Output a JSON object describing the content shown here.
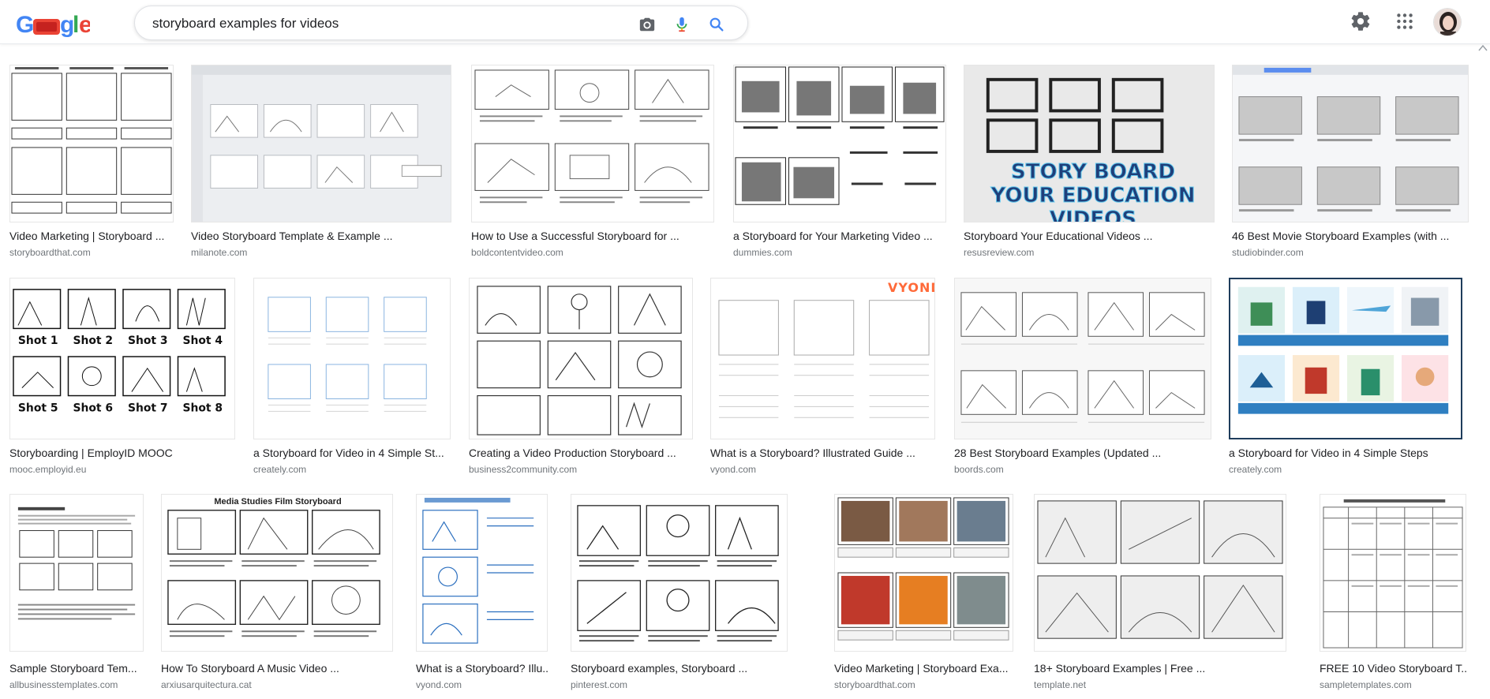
{
  "search": {
    "query": "storyboard examples for videos",
    "placeholder": ""
  },
  "logo": {
    "alt_text": "Google"
  },
  "colors": {
    "blue": "#4285f4",
    "red": "#ea4335",
    "yellow": "#fbbc05",
    "green": "#34a853",
    "text": "#202124",
    "source": "#70757a"
  },
  "icons": {
    "camera": "camera-icon",
    "mic": "mic-icon",
    "search": "search-icon",
    "settings": "gear-icon",
    "apps": "apps-grid-icon"
  },
  "results": [
    {
      "title": "Video Marketing | Storyboard ...",
      "source": "storyboardthat.com"
    },
    {
      "title": "Video Storyboard Template & Example ...",
      "source": "milanote.com"
    },
    {
      "title": "How to Use a Successful Storyboard for ...",
      "source": "boldcontentvideo.com"
    },
    {
      "title": "a Storyboard for Your Marketing Video ...",
      "source": "dummies.com"
    },
    {
      "title": "Storyboard Your Educational Videos ...",
      "source": "resusreview.com",
      "thumb_text": "STORY BOARD YOUR EDUCATION VIDEOS"
    },
    {
      "title": "46 Best Movie Storyboard Examples (with ...",
      "source": "studiobinder.com"
    },
    {
      "title": "Storyboarding | EmployID MOOC",
      "source": "mooc.employid.eu"
    },
    {
      "title": "a Storyboard for Video in 4 Simple St...",
      "source": "creately.com"
    },
    {
      "title": "Creating a Video Production Storyboard ...",
      "source": "business2community.com"
    },
    {
      "title": "What is a Storyboard? Illustrated Guide ...",
      "source": "vyond.com",
      "thumb_text": "VYOND"
    },
    {
      "title": "28 Best Storyboard Examples (Updated ...",
      "source": "boords.com"
    },
    {
      "title": "a Storyboard for Video in 4 Simple Steps",
      "source": "creately.com"
    },
    {
      "title": "Sample Storyboard Tem...",
      "source": "allbusinesstemplates.com"
    },
    {
      "title": "How To Storyboard A Music Video ...",
      "source": "arxiusarquitectura.cat",
      "thumb_text": "Media Studies Film Storyboard"
    },
    {
      "title": "What is a Storyboard? Illu...",
      "source": "vyond.com"
    },
    {
      "title": "Storyboard examples, Storyboard ...",
      "source": "pinterest.com"
    },
    {
      "title": "Video Marketing | Storyboard Exa...",
      "source": "storyboardthat.com"
    },
    {
      "title": "18+ Storyboard Examples | Free ...",
      "source": "template.net"
    },
    {
      "title": "FREE 10 Video Storyboard T...",
      "source": "sampletemplates.com"
    }
  ]
}
